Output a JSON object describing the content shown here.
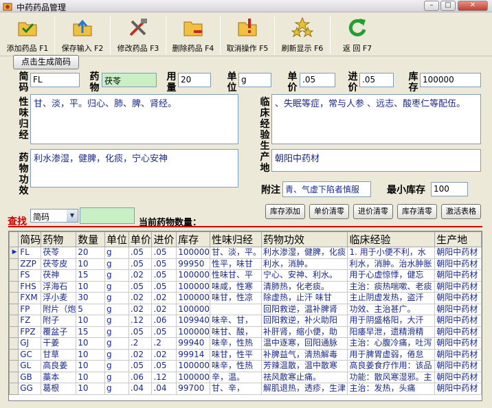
{
  "window": {
    "title": "中药药品管理"
  },
  "toolbar": [
    {
      "label": "添加药品 F1",
      "icon": "check-folder-icon"
    },
    {
      "label": "保存输入 F2",
      "icon": "upload-folder-icon"
    },
    {
      "label": "修改药品 F3",
      "icon": "tools-icon"
    },
    {
      "label": "删除药品 F4",
      "icon": "delete-folder-icon"
    },
    {
      "label": "取消操作 F5",
      "icon": "cancel-folder-icon"
    },
    {
      "label": "刷新显示 F6",
      "icon": "stars-icon"
    },
    {
      "label": "返  回 F7",
      "icon": "refresh-arrow-icon"
    }
  ],
  "form": {
    "gen_button": "点击生成简码",
    "code_label": "简码",
    "code_value": "FL",
    "drug_label": "药物",
    "drug_value": "茯苓",
    "dosage_label": "用量",
    "dosage_value": "20",
    "unit_label": "单位",
    "unit_value": "g",
    "unit_price_label": "单价",
    "unit_price_value": ".05",
    "purchase_price_label": "进价",
    "purchase_price_value": ".05",
    "stock_label": "库存",
    "stock_value": "100000",
    "nature_label": "性味归经",
    "nature_value": "甘、淡，平。归心、肺、脾、肾经。",
    "clinical_label": "临床经验",
    "clinical_value": "、失眠等症，常与人参 、远志、酸枣仁等配伍。",
    "efficacy_label": "药物功效",
    "efficacy_value": "利水渗湿，健脾，化痰，宁心安神",
    "origin_label": "生产地",
    "origin_value": "朝阳中药材",
    "note_label": "附注",
    "note_value": "青、气虚下陷者慎服",
    "min_stock_label": "最小库存",
    "min_stock_value": "100"
  },
  "actions": [
    "库存添加",
    "单价清零",
    "进价清零",
    "库存清零",
    "激活表格"
  ],
  "search": {
    "label": "查找",
    "field": "简码",
    "count_label": "当前药物数量："
  },
  "table": {
    "columns": [
      "简码",
      "药物",
      "数量",
      "单位",
      "单价",
      "进价",
      "库存",
      "性味归经",
      "药物功效",
      "临床经验",
      "生产地"
    ],
    "rows": [
      [
        "FL",
        "茯苓",
        "20",
        "g",
        ".05",
        ".05",
        "100000",
        "甘、淡，平。",
        "利水渗湿，健脾，化痰",
        "1. 用于小便不利，水",
        "朝阳中药材"
      ],
      [
        "ZZP",
        "茯苓皮",
        "10",
        "g",
        ".05",
        ".05",
        "99950",
        "性平，味甘",
        "利水，消肿。",
        "利水，消肿。治水肿胀",
        "朝阳中药材"
      ],
      [
        "FS",
        "茯神",
        "15",
        "g",
        ".02",
        ".05",
        "100000",
        "性味甘、平",
        "宁心、安神、利水。",
        "用于心虚惊悸，健忘",
        "朝阳中药材"
      ],
      [
        "FHS",
        "浮海石",
        "10",
        "g",
        ".05",
        ".05",
        "100000",
        "味咸，性寒",
        "清肺热，化老痰。",
        "主治：痰热喘嗽、老痰",
        "朝阳中药材"
      ],
      [
        "FXM",
        "浮小麦",
        "30",
        "g",
        ".02",
        ".02",
        "100000",
        "味甘，性凉",
        "除虚热，止汗 味甘",
        "主止阴虚发热，盗汗",
        "朝阳中药材"
      ],
      [
        "FP",
        "附片（炮",
        "5",
        "g",
        ".02",
        ".02",
        "100000",
        "",
        "回阳救逆，温补脾肾",
        "功效、主治甚广。",
        "朝阳中药材"
      ],
      [
        "FZ",
        "附子",
        "10",
        "g",
        ".12",
        ".06",
        "109940",
        "味辛、甘，",
        "回阳救逆，补火助阳",
        "用于阴盛格阳，大汗",
        "朝阳中药材"
      ],
      [
        "FPZ",
        "覆盆子",
        "15",
        "g",
        ".05",
        ".05",
        "100000",
        "味甘、酸，",
        "补肝肾，缩小便，助",
        "阳痿早泄，遗精滑精",
        "朝阳中药材"
      ],
      [
        "GJ",
        "干姜",
        "10",
        "g",
        ".2",
        ".2",
        "99940",
        "味辛，性热",
        "温中逐寒，回阳通脉",
        "主治：心腹冷痛，吐泻",
        "朝阳中药材"
      ],
      [
        "GC",
        "甘草",
        "10",
        "g",
        ".02",
        ".02",
        "99914",
        "味甘，性平",
        "补脾益气，清热解毒",
        "用于脾胃虚弱，倦怠",
        "朝阳中药材"
      ],
      [
        "GL",
        "高良姜",
        "10",
        "g",
        ".05",
        ".05",
        "100000",
        "味辛，性热",
        "芳辣温散，温中散寒",
        "高良姜食疗作用：该品",
        "朝阳中药材"
      ],
      [
        "GB",
        "藁本",
        "10",
        "g",
        ".06",
        ".12",
        "100000",
        "辛，温。",
        "祛风散寒止痛。",
        "功能：散风寒湿邪。主",
        "朝阳中药材"
      ],
      [
        "GG",
        "葛根",
        "10",
        "g",
        ".04",
        ".04",
        "99700",
        "甘、辛，",
        "解肌退热，透疹，生津",
        "主治：发热，头痛",
        "朝阳中药材"
      ]
    ]
  }
}
